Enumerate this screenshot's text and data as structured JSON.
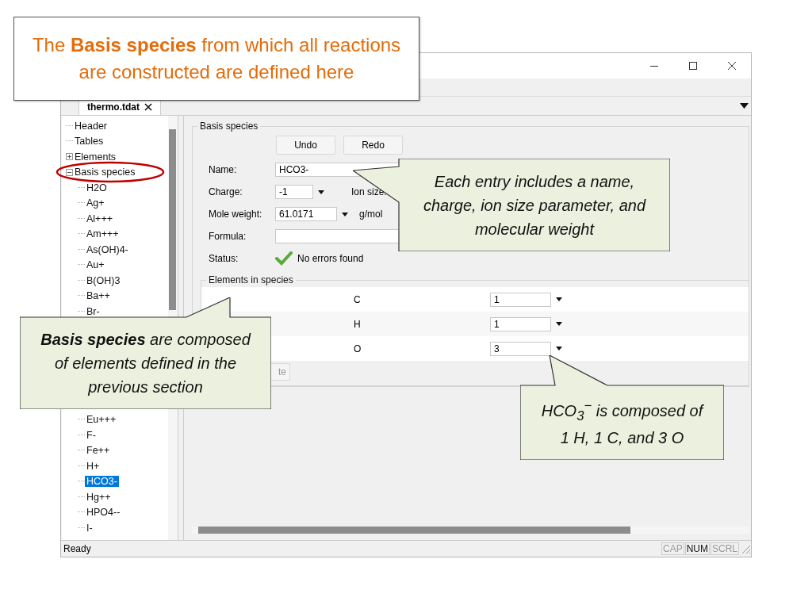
{
  "title_box": {
    "text": "The **Basis species** from which all reactions are constructed are defined here"
  },
  "tab": {
    "label": "thermo.tdat"
  },
  "tree": [
    {
      "label": "Header"
    },
    {
      "label": "Tables"
    },
    {
      "label": "Elements",
      "expanded": false
    },
    {
      "label": "Basis species",
      "expanded": true,
      "children": [
        {
          "label": "H2O",
          "selected": false
        },
        {
          "label": "Ag+",
          "selected": false
        },
        {
          "label": "Al+++",
          "selected": false
        },
        {
          "label": "Am+++",
          "selected": false
        },
        {
          "label": "As(OH)4-",
          "selected": false
        },
        {
          "label": "Au+",
          "selected": false
        },
        {
          "label": "B(OH)3",
          "selected": false
        },
        {
          "label": "Ba++",
          "selected": false
        },
        {
          "label": "Br-",
          "selected": false
        },
        {
          "label": "Eu+++",
          "selected": false
        },
        {
          "label": "F-",
          "selected": false
        },
        {
          "label": "Fe++",
          "selected": false
        },
        {
          "label": "H+",
          "selected": false
        },
        {
          "label": "HCO3-",
          "selected": true
        },
        {
          "label": "Hg++",
          "selected": false
        },
        {
          "label": "HPO4--",
          "selected": false
        },
        {
          "label": "I-",
          "selected": false
        }
      ]
    }
  ],
  "form": {
    "title": "Basis species",
    "buttons": [
      "Undo",
      "Redo"
    ],
    "fields": [
      {
        "label": "Name:",
        "kind": "text",
        "value": "HCO3-"
      },
      {
        "label": "Charge:",
        "kind": "combo",
        "value": "-1",
        "extra_label": "Ion size:"
      },
      {
        "label": "Mole weight:",
        "kind": "combo",
        "value": "61.0171",
        "unit": "g/mol"
      },
      {
        "label": "Formula:",
        "kind": "text"
      },
      {
        "label": "Status:",
        "kind": "status",
        "value": "No errors found"
      }
    ]
  },
  "elements_group": {
    "title": "Elements in species",
    "rows": [
      {
        "element": "C",
        "count": "1"
      },
      {
        "element": "H",
        "count": "1"
      },
      {
        "element": "O",
        "count": "3"
      }
    ],
    "button": "te"
  },
  "status_bar": {
    "text": "Ready",
    "indicators": [
      {
        "label": "CAP",
        "on": false
      },
      {
        "label": "NUM",
        "on": true
      },
      {
        "label": "SCRL",
        "on": false
      }
    ]
  },
  "callouts": [
    {
      "text": "Each entry includes a name, charge, ion size parameter, and molecular weight"
    },
    {
      "text": "**Basis species** are composed of elements defined in the previous section"
    },
    {
      "text": "HCO$_{3}$$^{−}$ is composed of 1 H, 1 C, and 3 O"
    }
  ]
}
